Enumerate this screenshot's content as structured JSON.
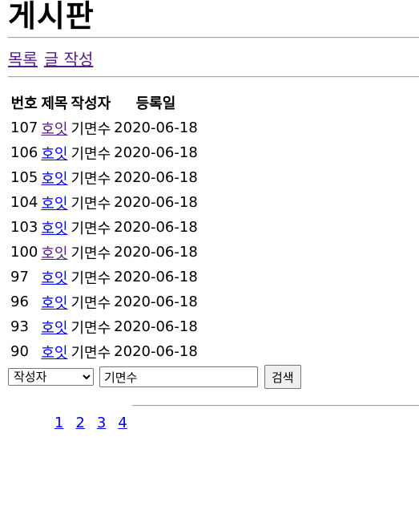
{
  "header": {
    "title": "게시판"
  },
  "nav": {
    "list_label": "목록",
    "write_label": "글 작성"
  },
  "table": {
    "columns": [
      "번호",
      "제목",
      "작성자",
      "등록일"
    ],
    "rows": [
      {
        "no": "107",
        "title": "호잇",
        "author": "기면수",
        "date": "2020-06-18",
        "visited": true
      },
      {
        "no": "106",
        "title": "호잇",
        "author": "기면수",
        "date": "2020-06-18",
        "visited": false
      },
      {
        "no": "105",
        "title": "호잇",
        "author": "기면수",
        "date": "2020-06-18",
        "visited": false
      },
      {
        "no": "104",
        "title": "호잇",
        "author": "기면수",
        "date": "2020-06-18",
        "visited": false
      },
      {
        "no": "103",
        "title": "호잇",
        "author": "기면수",
        "date": "2020-06-18",
        "visited": false
      },
      {
        "no": "100",
        "title": "호잇",
        "author": "기면수",
        "date": "2020-06-18",
        "visited": true
      },
      {
        "no": "97",
        "title": "호잇",
        "author": "기면수",
        "date": "2020-06-18",
        "visited": false
      },
      {
        "no": "96",
        "title": "호잇",
        "author": "기면수",
        "date": "2020-06-18",
        "visited": false
      },
      {
        "no": "93",
        "title": "호잇",
        "author": "기면수",
        "date": "2020-06-18",
        "visited": false
      },
      {
        "no": "90",
        "title": "호잇",
        "author": "기면수",
        "date": "2020-06-18",
        "visited": false
      }
    ]
  },
  "search": {
    "selected_option": "작성자",
    "input_value": "기면수",
    "button_label": "검색"
  },
  "pagination": {
    "pages": [
      "1",
      "2",
      "3",
      "4"
    ]
  },
  "colors": {
    "link": "#0000ee",
    "visited_link": "#551a8b",
    "rule": "#a8a8a8"
  }
}
